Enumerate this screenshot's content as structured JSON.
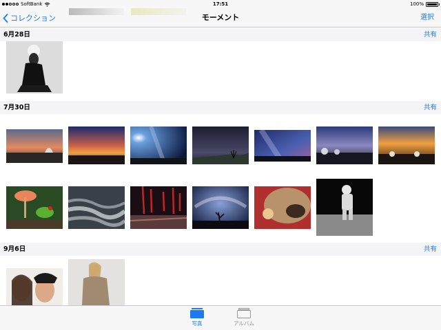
{
  "status_bar": {
    "carrier": "SoftBank",
    "time": "17:51",
    "battery": "100%",
    "battery_level": 1.0
  },
  "nav": {
    "back_label": "コレクション",
    "title": "モーメント",
    "select_label": "選択"
  },
  "sections": [
    {
      "date": "6月28日",
      "share_label": "共有",
      "photo_count": 1
    },
    {
      "date": "7月30日",
      "share_label": "共有",
      "photo_count": 13
    },
    {
      "date": "9月6日",
      "share_label": "共有",
      "photo_count": 2
    }
  ],
  "tabs": [
    {
      "label": "写真",
      "icon": "photos-icon",
      "active": true
    },
    {
      "label": "アルバム",
      "icon": "albums-icon",
      "active": false
    }
  ],
  "colors": {
    "accent": "#1a7bf2",
    "inactive_tab": "#929292",
    "header_bg": "#f4f4f6"
  }
}
